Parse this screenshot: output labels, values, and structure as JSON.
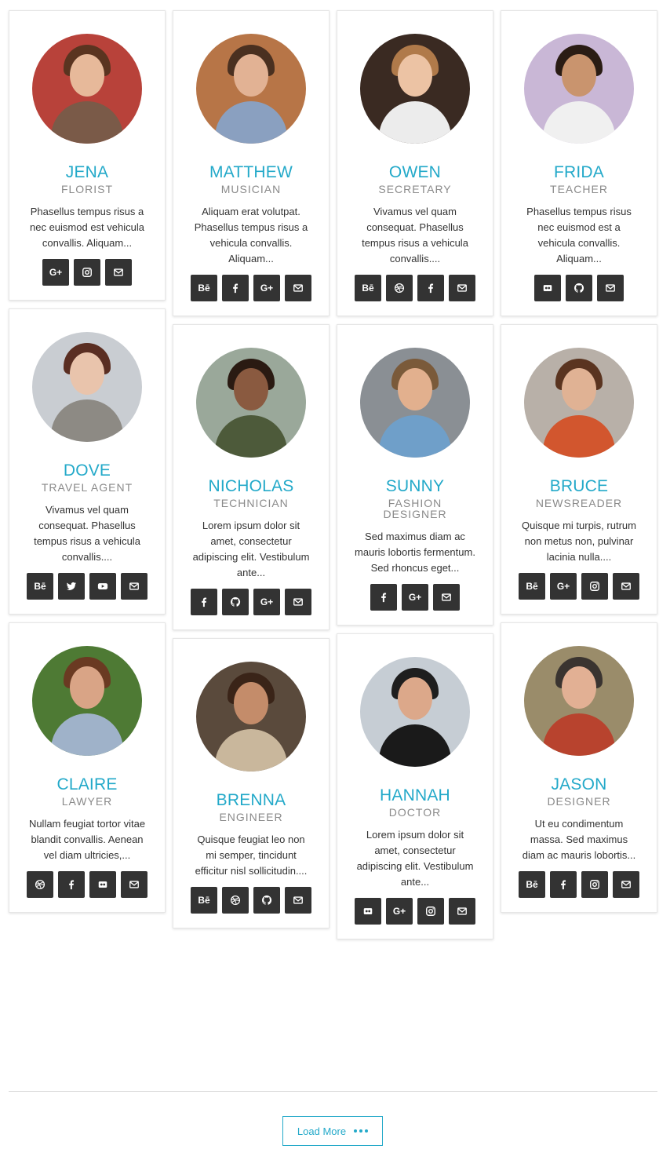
{
  "columns": [
    [
      {
        "name": "JENA",
        "role": "FLORIST",
        "desc": "Phasellus tempus risus a nec euismod est vehicula convallis. Aliquam...",
        "socials": [
          "google-plus",
          "instagram",
          "email"
        ],
        "colors": {
          "bg": "#b8423a",
          "skin": "#e7b99a",
          "hair": "#5a3420",
          "shirt": "#7a5a48"
        }
      },
      {
        "name": "DOVE",
        "role": "TRAVEL AGENT",
        "desc": "Vivamus vel quam consequat. Phasellus tempus risus a vehicula convallis....",
        "socials": [
          "behance",
          "twitter",
          "youtube",
          "email"
        ],
        "colors": {
          "bg": "#c9cdd2",
          "skin": "#e9c4ac",
          "hair": "#5a2e22",
          "shirt": "#8d8a84"
        }
      },
      {
        "name": "CLAIRE",
        "role": "LAWYER",
        "desc": "Nullam feugiat tortor vitae blandit convallis. Aenean vel diam ultricies,...",
        "socials": [
          "dribbble",
          "facebook",
          "flickr",
          "email"
        ],
        "colors": {
          "bg": "#4e7a34",
          "skin": "#d9a486",
          "hair": "#6a3a22",
          "shirt": "#9fb2c9"
        }
      }
    ],
    [
      {
        "name": "MATTHEW",
        "role": "MUSICIAN",
        "desc": "Aliquam erat volutpat. Phasellus tempus risus a vehicula convallis. Aliquam...",
        "socials": [
          "behance",
          "facebook",
          "google-plus",
          "email"
        ],
        "colors": {
          "bg": "#b77547",
          "skin": "#e2b294",
          "hair": "#4a3020",
          "shirt": "#8aa0c0"
        }
      },
      {
        "name": "NICHOLAS",
        "role": "TECHNICIAN",
        "desc": "Lorem ipsum dolor sit amet, consectetur adipiscing elit. Vestibulum ante...",
        "socials": [
          "facebook",
          "github",
          "google-plus",
          "email"
        ],
        "colors": {
          "bg": "#9aa89a",
          "skin": "#8a5a40",
          "hair": "#2a1a12",
          "shirt": "#4d5a3a"
        }
      },
      {
        "name": "BRENNA",
        "role": "ENGINEER",
        "desc": "Quisque feugiat leo non mi semper, tincidunt efficitur nisl sollicitudin....",
        "socials": [
          "behance",
          "dribbble",
          "github",
          "email"
        ],
        "colors": {
          "bg": "#5a4a3c",
          "skin": "#c48c6a",
          "hair": "#3a2418",
          "shirt": "#c9b79c"
        }
      }
    ],
    [
      {
        "name": "OWEN",
        "role": "SECRETARY",
        "desc": "Vivamus vel quam consequat. Phasellus tempus risus a vehicula convallis....",
        "socials": [
          "behance",
          "dribbble",
          "facebook",
          "email"
        ],
        "colors": {
          "bg": "#3a2a22",
          "skin": "#ecc3a4",
          "hair": "#b07a4a",
          "shirt": "#ececec"
        }
      },
      {
        "name": "SUNNY",
        "role": "FASHION DESIGNER",
        "desc": "Sed maximus diam ac mauris lobortis fermentum. Sed rhoncus eget...",
        "socials": [
          "facebook",
          "google-plus",
          "email"
        ],
        "colors": {
          "bg": "#8a8f94",
          "skin": "#e2b08e",
          "hair": "#7a5a3a",
          "shirt": "#6f9fc9"
        }
      },
      {
        "name": "HANNAH",
        "role": "DOCTOR",
        "desc": "Lorem ipsum dolor sit amet, consectetur adipiscing elit. Vestibulum ante...",
        "socials": [
          "flickr",
          "google-plus",
          "instagram",
          "email"
        ],
        "colors": {
          "bg": "#c6cdd4",
          "skin": "#dca88a",
          "hair": "#1e1e1e",
          "shirt": "#1a1a1a"
        }
      }
    ],
    [
      {
        "name": "FRIDA",
        "role": "TEACHER",
        "desc": "Phasellus tempus risus nec euismod est a vehicula convallis. Aliquam...",
        "socials": [
          "flickr",
          "github",
          "email"
        ],
        "colors": {
          "bg": "#c9b7d6",
          "skin": "#c9946e",
          "hair": "#2a1c14",
          "shirt": "#f0f0f0"
        }
      },
      {
        "name": "BRUCE",
        "role": "NEWSREADER",
        "desc": "Quisque mi turpis, rutrum non metus non, pulvinar lacinia nulla....",
        "socials": [
          "behance",
          "google-plus",
          "instagram",
          "email"
        ],
        "colors": {
          "bg": "#b8b0a8",
          "skin": "#e0b294",
          "hair": "#5a3420",
          "shirt": "#d2562e"
        }
      },
      {
        "name": "JASON",
        "role": "DESIGNER",
        "desc": "Ut eu condimentum massa. Sed maximus diam ac mauris lobortis...",
        "socials": [
          "behance",
          "facebook",
          "instagram",
          "email"
        ],
        "colors": {
          "bg": "#9a8c6a",
          "skin": "#e2b094",
          "hair": "#3a3430",
          "shirt": "#b8432e"
        }
      }
    ]
  ],
  "social_labels": {
    "google-plus": "G+",
    "behance": "Bē"
  },
  "load_more": {
    "label": "Load More"
  }
}
